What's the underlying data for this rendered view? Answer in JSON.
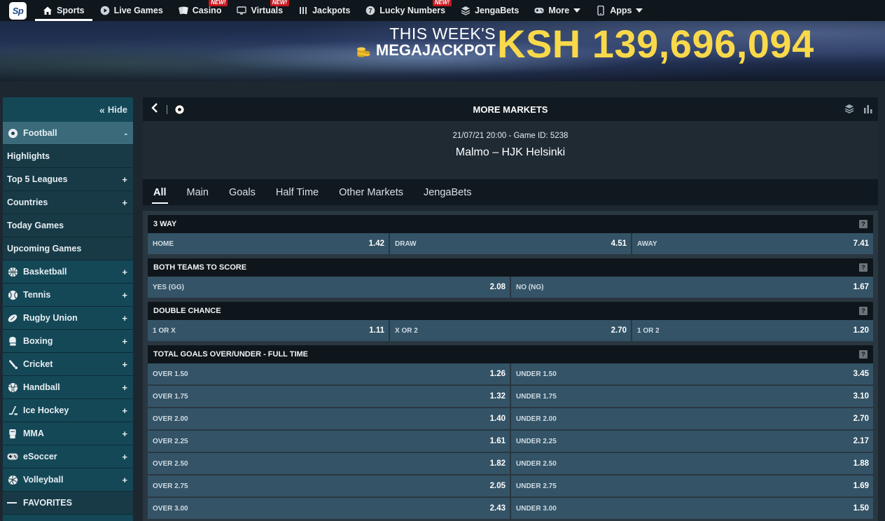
{
  "nav": {
    "logo": "Sp",
    "items": [
      {
        "label": "Sports",
        "icon": "home-icon",
        "active": true,
        "badge": ""
      },
      {
        "label": "Live Games",
        "icon": "play-icon",
        "active": false,
        "badge": ""
      },
      {
        "label": "Casino",
        "icon": "casino-icon",
        "active": false,
        "badge": "NEW!"
      },
      {
        "label": "Virtuals",
        "icon": "monitor-icon",
        "active": false,
        "badge": "NEW!"
      },
      {
        "label": "Jackpots",
        "icon": "jackpot-icon",
        "active": false,
        "badge": ""
      },
      {
        "label": "Lucky Numbers",
        "icon": "lucky-icon",
        "active": false,
        "badge": "NEW!"
      },
      {
        "label": "JengaBets",
        "icon": "stack-icon",
        "active": false,
        "badge": ""
      },
      {
        "label": "More",
        "icon": "gamepad-icon",
        "active": false,
        "badge": ""
      },
      {
        "label": "Apps",
        "icon": "phone-icon",
        "active": false,
        "badge": ""
      }
    ]
  },
  "banner": {
    "line1": "THIS WEEK'S",
    "line2": "MEGAJACKPOT",
    "amount": "KSH 139,696,094"
  },
  "sidebar": {
    "hide_label": "Hide",
    "items": [
      {
        "label": "Football",
        "icon": "football-icon",
        "toggle": "-",
        "type": "sport",
        "active": true
      },
      {
        "label": "Highlights",
        "icon": "",
        "toggle": "",
        "type": "link",
        "active": false
      },
      {
        "label": "Top 5 Leagues",
        "icon": "",
        "toggle": "+",
        "type": "link",
        "active": false
      },
      {
        "label": "Countries",
        "icon": "",
        "toggle": "+",
        "type": "link",
        "active": false
      },
      {
        "label": "Today Games",
        "icon": "",
        "toggle": "",
        "type": "link",
        "active": false
      },
      {
        "label": "Upcoming Games",
        "icon": "",
        "toggle": "",
        "type": "link",
        "active": false
      },
      {
        "label": "Basketball",
        "icon": "basketball-icon",
        "toggle": "+",
        "type": "sport",
        "active": false
      },
      {
        "label": "Tennis",
        "icon": "tennis-icon",
        "toggle": "+",
        "type": "sport",
        "active": false
      },
      {
        "label": "Rugby Union",
        "icon": "rugby-icon",
        "toggle": "+",
        "type": "sport",
        "active": false
      },
      {
        "label": "Boxing",
        "icon": "boxing-icon",
        "toggle": "+",
        "type": "sport",
        "active": false
      },
      {
        "label": "Cricket",
        "icon": "cricket-icon",
        "toggle": "+",
        "type": "sport",
        "active": false
      },
      {
        "label": "Handball",
        "icon": "handball-icon",
        "toggle": "+",
        "type": "sport",
        "active": false
      },
      {
        "label": "Ice Hockey",
        "icon": "hockey-icon",
        "toggle": "+",
        "type": "sport",
        "active": false
      },
      {
        "label": "MMA",
        "icon": "mma-icon",
        "toggle": "+",
        "type": "sport",
        "active": false
      },
      {
        "label": "eSoccer",
        "icon": "gamepad-icon",
        "toggle": "+",
        "type": "sport",
        "active": false
      },
      {
        "label": "Volleyball",
        "icon": "volleyball-icon",
        "toggle": "+",
        "type": "sport",
        "active": false
      }
    ],
    "favorites_label": "FAVORITES"
  },
  "main": {
    "header_title": "MORE MARKETS",
    "date_line": "21/07/21 20:00 - Game ID: 5238",
    "match": "Malmo – HJK Helsinki",
    "tabs": [
      "All",
      "Main",
      "Goals",
      "Half Time",
      "Other Markets",
      "JengaBets"
    ],
    "active_tab": "All",
    "help_label": "?"
  },
  "markets": [
    {
      "title": "3 WAY",
      "rows": [
        [
          {
            "label": "HOME",
            "odd": "1.42"
          },
          {
            "label": "DRAW",
            "odd": "4.51"
          },
          {
            "label": "AWAY",
            "odd": "7.41"
          }
        ]
      ]
    },
    {
      "title": "BOTH TEAMS TO SCORE",
      "rows": [
        [
          {
            "label": "YES (GG)",
            "odd": "2.08"
          },
          {
            "label": "NO (NG)",
            "odd": "1.67"
          }
        ]
      ]
    },
    {
      "title": "DOUBLE CHANCE",
      "rows": [
        [
          {
            "label": "1 OR X",
            "odd": "1.11"
          },
          {
            "label": "X OR 2",
            "odd": "2.70"
          },
          {
            "label": "1 OR 2",
            "odd": "1.20"
          }
        ]
      ]
    },
    {
      "title": "TOTAL GOALS OVER/UNDER - FULL TIME",
      "rows": [
        [
          {
            "label": "OVER 1.50",
            "odd": "1.26"
          },
          {
            "label": "UNDER 1.50",
            "odd": "3.45"
          }
        ],
        [
          {
            "label": "OVER 1.75",
            "odd": "1.32"
          },
          {
            "label": "UNDER 1.75",
            "odd": "3.10"
          }
        ],
        [
          {
            "label": "OVER 2.00",
            "odd": "1.40"
          },
          {
            "label": "UNDER 2.00",
            "odd": "2.70"
          }
        ],
        [
          {
            "label": "OVER 2.25",
            "odd": "1.61"
          },
          {
            "label": "UNDER 2.25",
            "odd": "2.17"
          }
        ],
        [
          {
            "label": "OVER 2.50",
            "odd": "1.82"
          },
          {
            "label": "UNDER 2.50",
            "odd": "1.88"
          }
        ],
        [
          {
            "label": "OVER 2.75",
            "odd": "2.05"
          },
          {
            "label": "UNDER 2.75",
            "odd": "1.69"
          }
        ],
        [
          {
            "label": "OVER 3.00",
            "odd": "2.43"
          },
          {
            "label": "UNDER 3.00",
            "odd": "1.50"
          }
        ]
      ]
    }
  ]
}
